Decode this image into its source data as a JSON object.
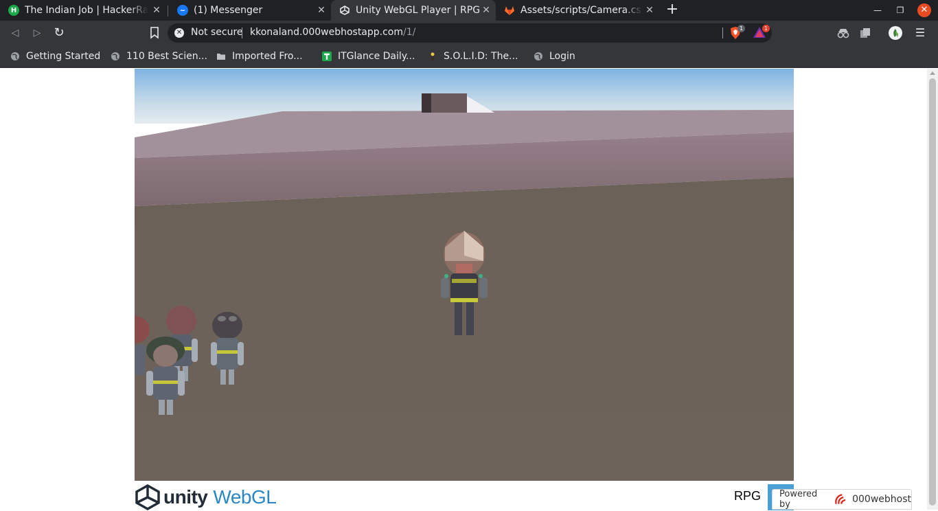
{
  "browser": {
    "tabs": [
      {
        "title": "The Indian Job | HackerRank",
        "favicon": "hackerrank-icon",
        "favicon_color": "#1ba94c",
        "active": false
      },
      {
        "title": "(1) Messenger",
        "favicon": "messenger-icon",
        "favicon_color": "#1877f2",
        "active": false
      },
      {
        "title": "Unity WebGL Player | RPG",
        "favicon": "unity-icon",
        "favicon_color": "#e8eaed",
        "active": true
      },
      {
        "title": "Assets/scripts/Camera.cs · master",
        "favicon": "gitlab-icon",
        "favicon_color": "#fc6d26",
        "active": false
      }
    ],
    "new_tab_label": "+",
    "address": {
      "security_label": "Not secure",
      "host": "kkonaland.000webhostapp.com",
      "path": "/1/"
    },
    "shields_count": "1",
    "rewards_count": "1",
    "bookmarks": [
      {
        "label": "Getting Started",
        "icon": "globe-icon"
      },
      {
        "label": "110 Best Scien...",
        "icon": "globe-icon"
      },
      {
        "label": "Imported Fro...",
        "icon": "folder-icon"
      },
      {
        "label": "ITGlance Daily...",
        "icon": "itglance-icon"
      },
      {
        "label": "S.O.L.I.D: The...",
        "icon": "solid-icon"
      },
      {
        "label": "Login",
        "icon": "globe-icon"
      }
    ]
  },
  "page": {
    "unity_label": "unity",
    "webgl_label": "WebGL",
    "game_title": "RPG",
    "powered_by_label": "Powered by",
    "host_label": "000webhost"
  },
  "colors": {
    "sky_top": "#7fb3e3",
    "sky_horizon": "#d9e6ee",
    "wall_top": "#a2919b",
    "wall_face": "#8a737c",
    "ground": "#6d6259",
    "unity_blue": "#2a87c6"
  }
}
